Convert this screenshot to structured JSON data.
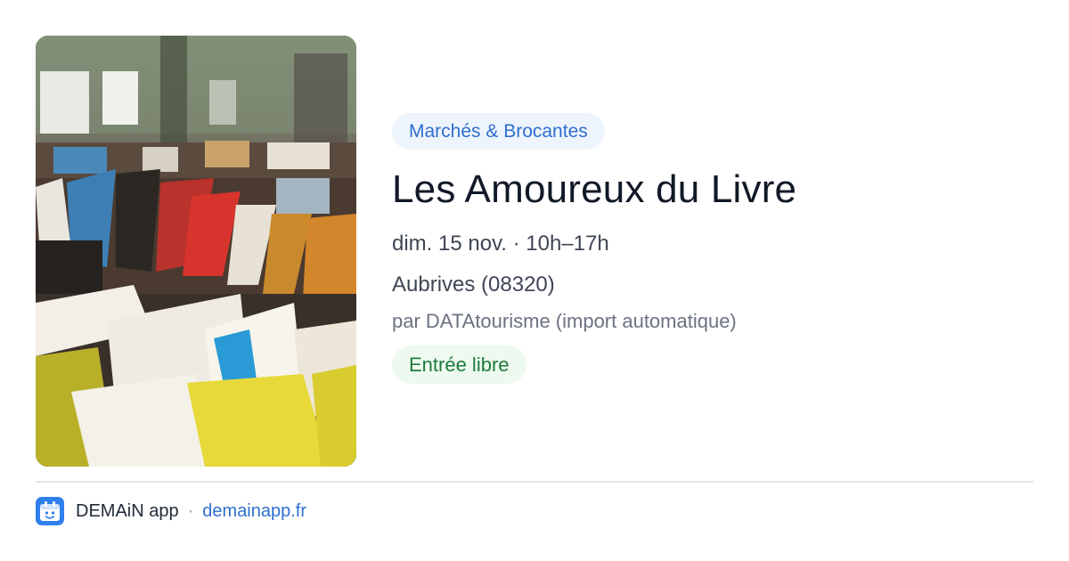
{
  "event": {
    "image_icon": "books-market-photo",
    "category": "Marchés & Brocantes",
    "title": "Les Amoureux du Livre",
    "datetime": "dim. 15 nov. · 10h–17h",
    "location": "Aubrives (08320)",
    "source": "par DATAtourisme (import automatique)",
    "price": "Entrée libre"
  },
  "footer": {
    "logo_icon": "demain-app-logo-icon",
    "app_name": "DEMAiN app",
    "separator": "·",
    "link_text": "demainapp.fr"
  },
  "colors": {
    "accent": "#2f6fce",
    "category_bg": "#eef4fc",
    "price_text": "#1f7a3a",
    "price_bg": "#eefaf0",
    "title": "#111827",
    "logo_bg": "#2f80ed"
  }
}
